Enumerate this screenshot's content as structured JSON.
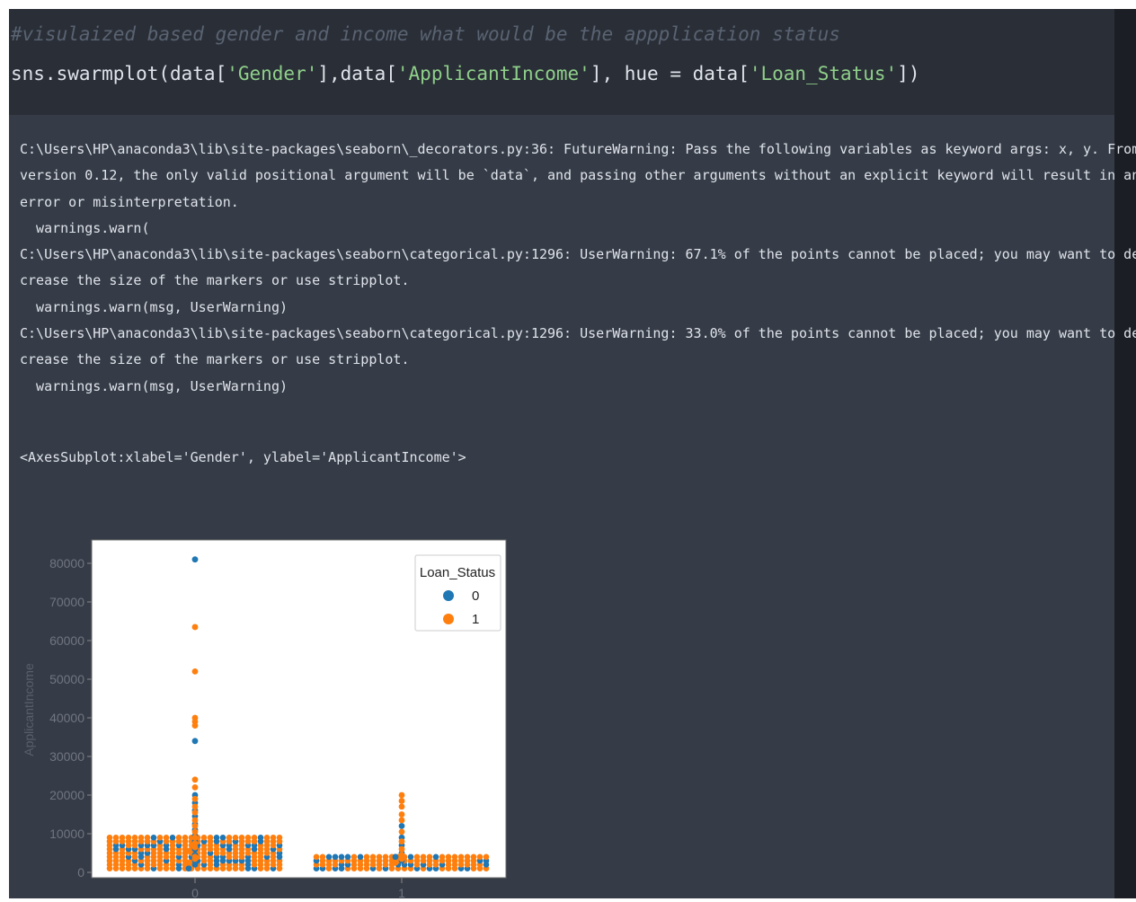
{
  "cell": {
    "comment": "#visulaized based gender and income what would be the appplication status",
    "code_tokens": [
      {
        "text": "sns.swarmplot(data[",
        "kind": "plain"
      },
      {
        "text": "'Gender'",
        "kind": "string"
      },
      {
        "text": "],data[",
        "kind": "plain"
      },
      {
        "text": "'ApplicantIncome'",
        "kind": "string"
      },
      {
        "text": "], hue = data[",
        "kind": "plain"
      },
      {
        "text": "'Loan_Status'",
        "kind": "string"
      },
      {
        "text": "])",
        "kind": "plain"
      }
    ]
  },
  "output": {
    "lines": [
      "C:\\Users\\HP\\anaconda3\\lib\\site-packages\\seaborn\\_decorators.py:36: FutureWarning: Pass the following variables as keyword args: x, y. From",
      "version 0.12, the only valid positional argument will be `data`, and passing other arguments without an explicit keyword will result in an",
      "error or misinterpretation.",
      "  warnings.warn(",
      "C:\\Users\\HP\\anaconda3\\lib\\site-packages\\seaborn\\categorical.py:1296: UserWarning: 67.1% of the points cannot be placed; you may want to de",
      "crease the size of the markers or use stripplot.",
      "  warnings.warn(msg, UserWarning)",
      "C:\\Users\\HP\\anaconda3\\lib\\site-packages\\seaborn\\categorical.py:1296: UserWarning: 33.0% of the points cannot be placed; you may want to de",
      "crease the size of the markers or use stripplot.",
      "  warnings.warn(msg, UserWarning)"
    ],
    "repr": "<AxesSubplot:xlabel='Gender', ylabel='ApplicantIncome'>"
  },
  "chart_data": {
    "type": "scatter",
    "subtype": "swarm",
    "ylabel": "ApplicantIncome",
    "xlabel": "",
    "categories": [
      "0",
      "1"
    ],
    "ylim": [
      0,
      83000
    ],
    "yticks": [
      0,
      10000,
      20000,
      30000,
      40000,
      50000,
      60000,
      70000,
      80000
    ],
    "grid": false,
    "legend": {
      "title": "Loan_Status",
      "placement": "top-right"
    },
    "series": [
      {
        "name": "0",
        "color": "#1f77b4",
        "points": [
          {
            "x": 0,
            "y": 81000
          },
          {
            "x": 0,
            "y": 34000
          },
          {
            "x": 0,
            "y": 20000
          },
          {
            "x": 0,
            "y": 18000
          },
          {
            "x": 0,
            "y": 16000
          },
          {
            "x": 0,
            "y": 14500
          },
          {
            "x": 0,
            "y": 12500
          },
          {
            "x": 0,
            "y": 11000
          },
          {
            "x": 0,
            "y": 9500
          },
          {
            "x": 0,
            "y": 8000
          },
          {
            "x": 0,
            "y": 6000
          },
          {
            "x": 0,
            "y": 4500
          },
          {
            "x": 0,
            "y": 3000
          },
          {
            "x": 0,
            "y": 2000
          },
          {
            "x": 0,
            "y": 1000
          },
          {
            "x": 1,
            "y": 12000
          },
          {
            "x": 1,
            "y": 9000
          },
          {
            "x": 1,
            "y": 7000
          },
          {
            "x": 1,
            "y": 5000
          },
          {
            "x": 1,
            "y": 4000
          },
          {
            "x": 1,
            "y": 3000
          }
        ]
      },
      {
        "name": "1",
        "color": "#ff7f0e",
        "points": [
          {
            "x": 0,
            "y": 63500
          },
          {
            "x": 0,
            "y": 52000
          },
          {
            "x": 0,
            "y": 40000
          },
          {
            "x": 0,
            "y": 39000
          },
          {
            "x": 0,
            "y": 38000
          },
          {
            "x": 0,
            "y": 24000
          },
          {
            "x": 0,
            "y": 22000
          },
          {
            "x": 0,
            "y": 19000
          },
          {
            "x": 0,
            "y": 17000
          },
          {
            "x": 0,
            "y": 15500
          },
          {
            "x": 0,
            "y": 13500
          },
          {
            "x": 0,
            "y": 12000
          },
          {
            "x": 0,
            "y": 10500
          },
          {
            "x": 0,
            "y": 9000
          },
          {
            "x": 0,
            "y": 7500
          },
          {
            "x": 0,
            "y": 6500
          },
          {
            "x": 0,
            "y": 5500
          },
          {
            "x": 0,
            "y": 4000
          },
          {
            "x": 0,
            "y": 3500
          },
          {
            "x": 0,
            "y": 2500
          },
          {
            "x": 1,
            "y": 20000
          },
          {
            "x": 1,
            "y": 18500
          },
          {
            "x": 1,
            "y": 17000
          },
          {
            "x": 1,
            "y": 15000
          },
          {
            "x": 1,
            "y": 13500
          },
          {
            "x": 1,
            "y": 10500
          },
          {
            "x": 1,
            "y": 8000
          },
          {
            "x": 1,
            "y": 6000
          },
          {
            "x": 1,
            "y": 4500
          },
          {
            "x": 1,
            "y": 3500
          },
          {
            "x": 1,
            "y": 2500
          }
        ]
      }
    ]
  }
}
